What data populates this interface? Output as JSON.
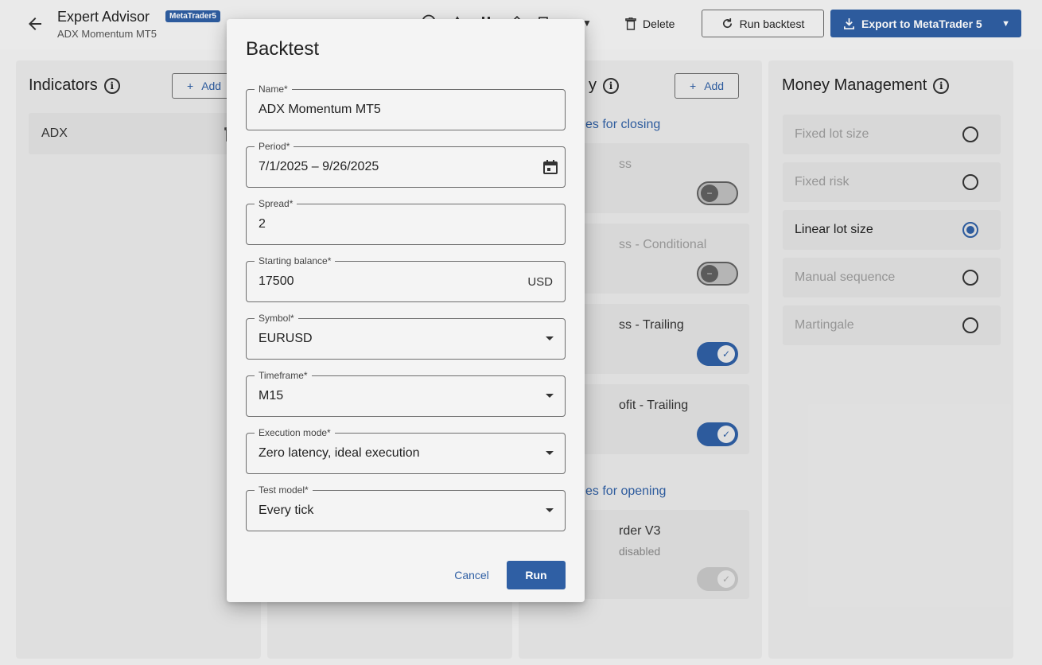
{
  "header": {
    "title": "Expert Advisor",
    "badge": "MetaTrader5",
    "subtitle": "ADX Momentum MT5",
    "delete_label": "Delete",
    "run_backtest_label": "Run backtest",
    "export_label": "Export to MetaTrader 5"
  },
  "indicators": {
    "title": "Indicators",
    "add_label": "Add",
    "items": [
      {
        "label": "ADX"
      }
    ]
  },
  "strategy": {
    "add_label": "Add",
    "closing_link": "es for closing",
    "opening_link": "es for opening",
    "cards": [
      {
        "title": "ss",
        "muted": true,
        "toggle": "off"
      },
      {
        "title": "ss - Conditional",
        "muted": true,
        "toggle": "off"
      },
      {
        "title": "ss - Trailing",
        "muted": false,
        "toggle": "on"
      },
      {
        "title": "ofit - Trailing",
        "muted": false,
        "toggle": "on"
      },
      {
        "title": "rder V3",
        "subtitle": "disabled",
        "muted": false,
        "toggle": "on-disabled"
      }
    ]
  },
  "money_management": {
    "title": "Money Management",
    "options": [
      {
        "label": "Fixed lot size",
        "selected": false
      },
      {
        "label": "Fixed risk",
        "selected": false
      },
      {
        "label": "Linear lot size",
        "selected": true
      },
      {
        "label": "Manual sequence",
        "selected": false
      },
      {
        "label": "Martingale",
        "selected": false
      }
    ]
  },
  "dialog": {
    "title": "Backtest",
    "fields": {
      "name": {
        "label": "Name*",
        "value": "ADX Momentum MT5"
      },
      "period": {
        "label": "Period*",
        "value": "7/1/2025 – 9/26/2025"
      },
      "spread": {
        "label": "Spread*",
        "value": "2"
      },
      "balance": {
        "label": "Starting balance*",
        "value": "17500",
        "suffix": "USD"
      },
      "symbol": {
        "label": "Symbol*",
        "value": "EURUSD"
      },
      "timeframe": {
        "label": "Timeframe*",
        "value": "M15"
      },
      "execution": {
        "label": "Execution mode*",
        "value": "Zero latency, ideal execution"
      },
      "test_model": {
        "label": "Test model*",
        "value": "Every tick"
      }
    },
    "cancel_label": "Cancel",
    "run_label": "Run"
  },
  "colors": {
    "accent": "#2f5fa4",
    "background": "#f2f2f2",
    "card": "#e1e1e1"
  }
}
